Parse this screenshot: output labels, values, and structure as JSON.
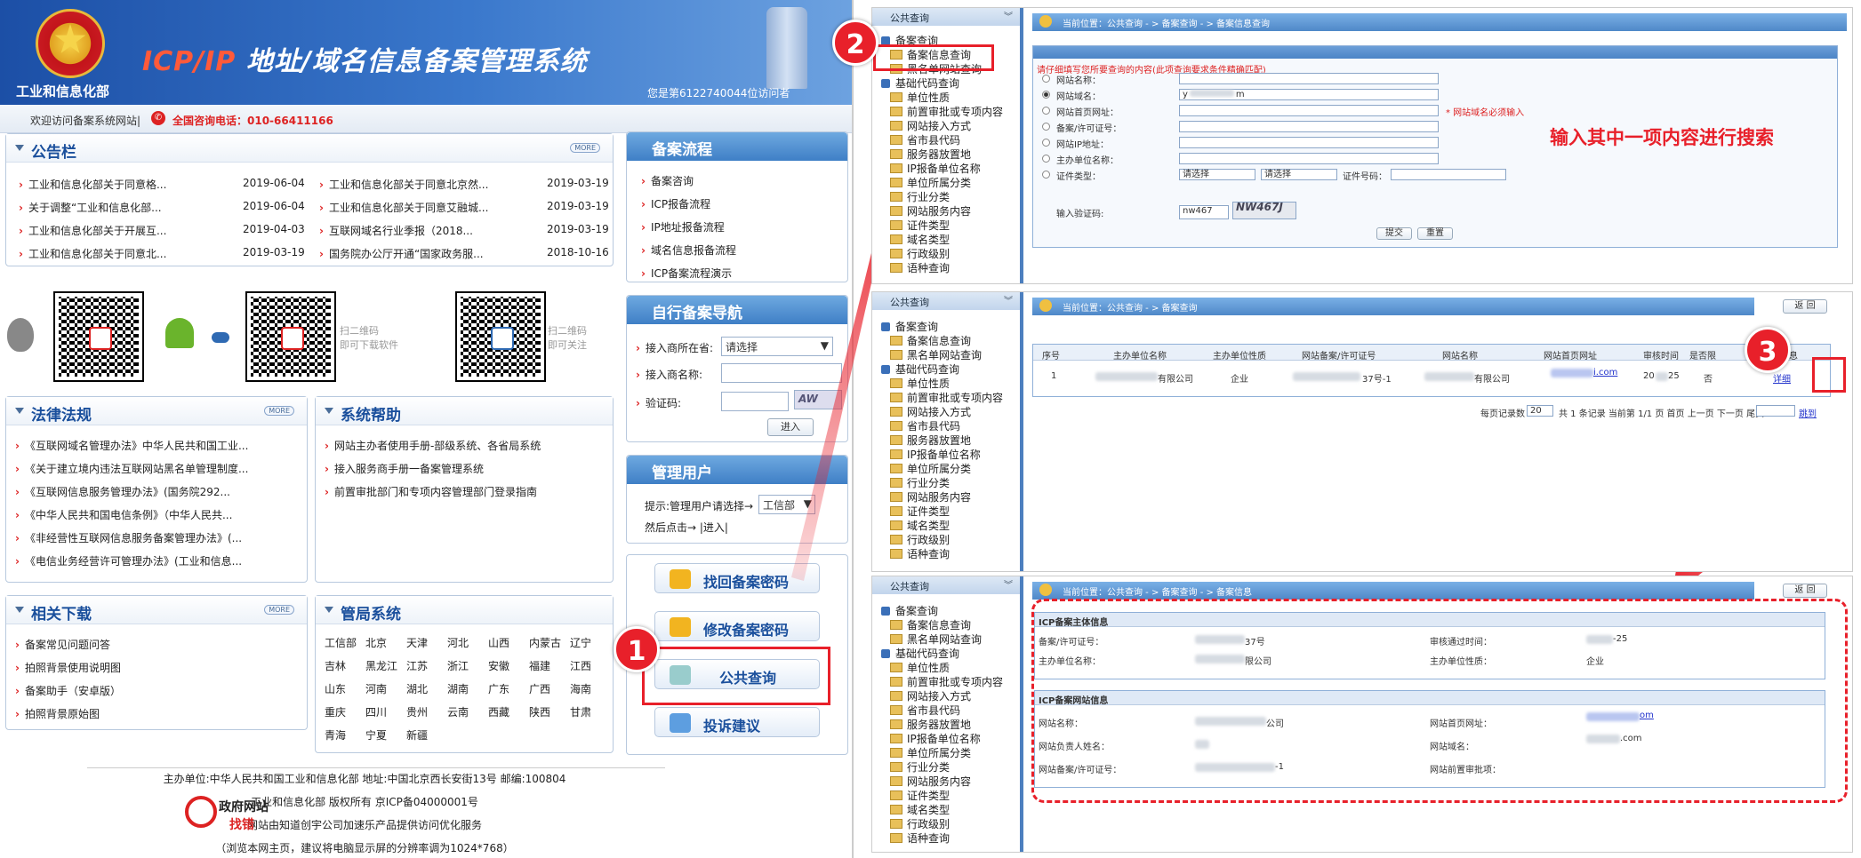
{
  "portal": {
    "ministry": "工业和信息化部",
    "title_icp": "ICP/IP",
    "title_rest": " 地址/域名信息备案管理系统",
    "visits": "您是第6122740044位访问者",
    "welcome": "欢迎访问备案系统网站|",
    "hotline": "全国咨询电话：010-66411166"
  },
  "notice": {
    "title": "公告栏",
    "more": "MORE",
    "items": [
      {
        "t": "工业和信息化部关于同意格...",
        "d": "2019-06-04"
      },
      {
        "t": "关于调整“工业和信息化部...",
        "d": "2019-06-04"
      },
      {
        "t": "工业和信息化部关于开展互...",
        "d": "2019-04-03"
      },
      {
        "t": "工业和信息化部关于同意北...",
        "d": "2019-03-19"
      },
      {
        "t": "工业和信息化部关于同意北京然...",
        "d": "2019-03-19"
      },
      {
        "t": "工业和信息化部关于同意艾融城...",
        "d": "2019-03-19"
      },
      {
        "t": "互联网域名行业季报（2018...",
        "d": "2019-03-19"
      },
      {
        "t": "国务院办公厅开通“国家政务服...",
        "d": "2018-10-16"
      }
    ]
  },
  "qr": {
    "scan1": "扫二维码",
    "scan1b": "即可下载软件",
    "scan2": "扫二维码",
    "scan2b": "即可关注"
  },
  "flow": {
    "title": "备案流程",
    "items": [
      "备案咨询",
      "ICP报备流程",
      "IP地址报备流程",
      "域名信息报备流程",
      "ICP备案流程演示"
    ]
  },
  "selfnav": {
    "title": "自行备案导航",
    "province_label": "接入商所在省:",
    "province_value": "请选择",
    "isp_label": "接入商名称:",
    "captcha_label": "验证码:",
    "captcha_img": "AW",
    "enter": "进入"
  },
  "admin": {
    "title": "管理用户",
    "tip": "提示:管理用户请选择→",
    "select": "工信部",
    "tip2": "然后点击→ |进入|"
  },
  "law": {
    "title": "法律法规",
    "more": "MORE",
    "items": [
      "《互联网域名管理办法》中华人民共和国工业...",
      "《关于建立境内违法互联网站黑名单管理制度...",
      "《互联网信息服务管理办法》(国务院292...",
      "《中华人民共和国电信条例》（中华人民共...",
      "《非经营性互联网信息服务备案管理办法》(...",
      "《电信业务经营许可管理办法》(工业和信息..."
    ]
  },
  "help": {
    "title": "系统帮助",
    "items": [
      "网站主办者使用手册-部级系统、各省局系统",
      "接入服务商手册一备案管理系统",
      "前置审批部门和专项内容管理部门登录指南"
    ]
  },
  "download": {
    "title": "相关下载",
    "more": "MORE",
    "items": [
      "备案常见问题问答",
      "拍照背景使用说明图",
      "备案助手（安卓版）",
      "拍照背景原始图"
    ]
  },
  "bureau": {
    "title": "管局系统",
    "cities": [
      "工信部",
      "北京",
      "天津",
      "河北",
      "山西",
      "内蒙古",
      "辽宁",
      "吉林",
      "黑龙江",
      "江苏",
      "浙江",
      "安徽",
      "福建",
      "江西",
      "山东",
      "河南",
      "湖北",
      "湖南",
      "广东",
      "广西",
      "海南",
      "重庆",
      "四川",
      "贵州",
      "云南",
      "西藏",
      "陕西",
      "甘肃",
      "青海",
      "宁夏",
      "新疆"
    ]
  },
  "buttons": [
    "找回备案密码",
    "修改备案密码",
    "公共查询",
    "投诉建议"
  ],
  "footer": {
    "l1": "主办单位:中华人民共和国工业和信息化部 地址:中国北京西长安街13号 邮编:100804",
    "l2": "工业和信息化部 版权所有 京ICP备04000001号",
    "l3": "网站由知道创宇公司加速乐产品提供访问优化服务",
    "l4": "（浏览本网主页，建议将电脑显示屏的分辨率调为1024*768）",
    "gov1": "政府网站",
    "gov2": "找错"
  },
  "badges": [
    "1",
    "2",
    "3"
  ],
  "annotation": "输入其中一项内容进行搜索",
  "tree": {
    "header": "公共查询",
    "items": [
      "备案查询",
      "备案信息查询",
      "黑名单网站查询",
      "基础代码查询",
      "单位性质",
      "前置审批或专项内容",
      "网站接入方式",
      "省市县代码",
      "服务器放置地",
      "IP报备单位名称",
      "单位所属分类",
      "行业分类",
      "网站服务内容",
      "证件类型",
      "域名类型",
      "行政级别",
      "语种查询"
    ]
  },
  "screen1": {
    "crumb": "当前位置：公共查询 - > 备案查询 - > 备案信息查询",
    "hint": "请仔细填写您所要查询的内容(此项查询要求条件精确匹配)",
    "fields": [
      "网站名称：",
      "网站域名：",
      "网站首页网址：",
      "备案/许可证号：",
      "网站IP地址：",
      "主办单位名称：",
      "证件类型："
    ],
    "domain_value": "y",
    "domain_value2": "m",
    "required": "* 网站域名必须输入",
    "sel1": "请选择",
    "sel2": "请选择",
    "certno": "证件号码：",
    "captcha_label": "输入验证码:",
    "captcha_value": "nw467",
    "captcha_img": "NW467J",
    "submit": "提交",
    "reset": "重置"
  },
  "screen2": {
    "crumb": "当前位置：公共查询 - > 备案查询",
    "back": "返 回",
    "headers": [
      "序号",
      "主办单位名称",
      "主办单位性质",
      "网站备案/许可证号",
      "网站名称",
      "网站首页网址",
      "审核时间",
      "是否限",
      "详细信息"
    ],
    "row": {
      "no": "1",
      "org": "有限公司",
      "type": "企业",
      "lic": "37号-1",
      "name": "有限公司",
      "url": "i.com",
      "time": "25",
      "limit": "否",
      "detail": "详细"
    },
    "pager": "每页记录数",
    "pagesize": "20",
    "pager2": "共 1 条记录  当前第 1/1 页 首页 上一页 下一页 尾页",
    "jump": "跳到"
  },
  "screen3": {
    "crumb": "当前位置：公共查询 - > 备案查询 - > 备案信息",
    "back": "返 回",
    "sec1": "ICP备案主体信息",
    "sec1_rows": [
      {
        "l": "备案/许可证号：",
        "v": "37号",
        "l2": "审核通过时间：",
        "v2": "-25"
      },
      {
        "l": "主办单位名称：",
        "v": "限公司",
        "l2": "主办单位性质：",
        "v2": "企业"
      }
    ],
    "sec2": "ICP备案网站信息",
    "sec2_rows": [
      {
        "l": "网站名称：",
        "v": "公司",
        "l2": "网站首页网址：",
        "v2": "om"
      },
      {
        "l": "网站负责人姓名：",
        "v": "",
        "l2": "网站域名：",
        "v2": ".com"
      },
      {
        "l": "网站备案/许可证号：",
        "v": "-1",
        "l2": "网站前置审批项：",
        "v2": ""
      }
    ]
  }
}
